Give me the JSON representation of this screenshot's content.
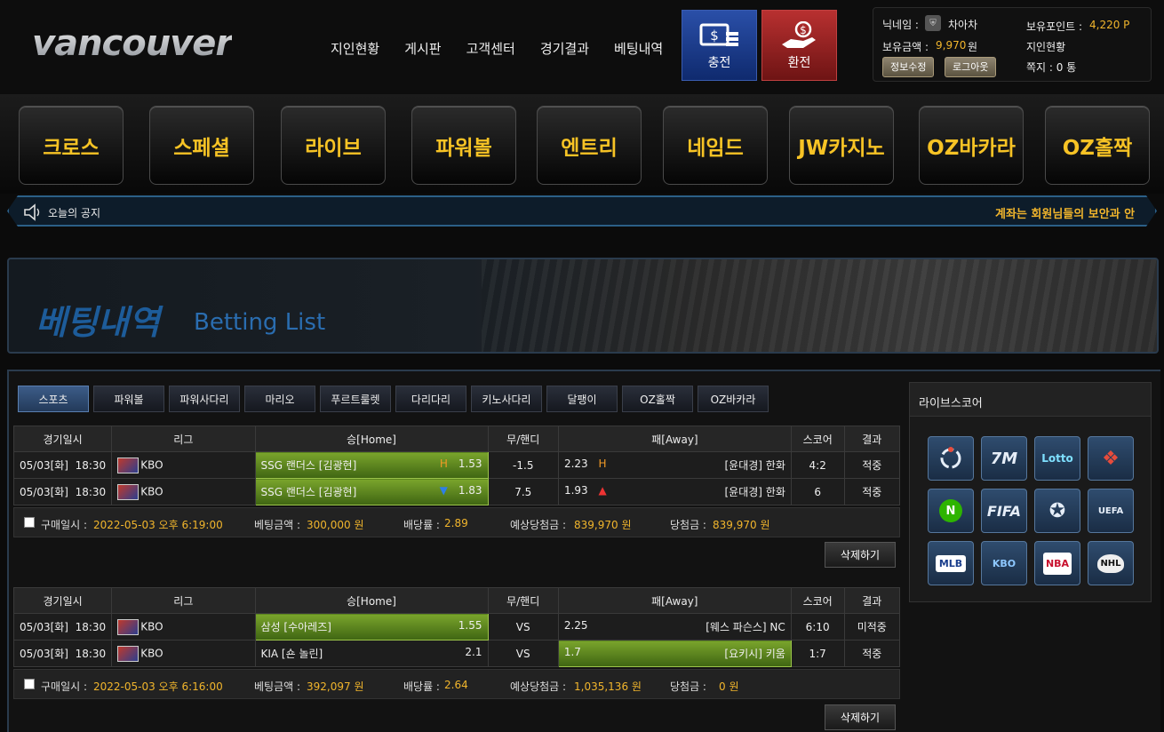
{
  "header": {
    "logo": "vancouver",
    "nav": [
      "지인현황",
      "게시판",
      "고객센터",
      "경기결과",
      "베팅내역"
    ],
    "charge_label": "충전",
    "exchange_label": "환전"
  },
  "user": {
    "nickname_label": "닉네임 :",
    "nickname": "차아차",
    "points_label": "보유포인트 :",
    "points": "4,220 P",
    "balance_label": "보유금액 :",
    "balance": "9,970",
    "balance_unit": "원",
    "friends_label": "지인현황",
    "memo_label": "쪽지 : 0 통",
    "edit_btn": "정보수정",
    "logout_btn": "로그아웃"
  },
  "games": [
    "크로스",
    "스페셜",
    "라이브",
    "파워볼",
    "엔트리",
    "네임드",
    "JW카지노",
    "OZ바카라",
    "OZ홀짝"
  ],
  "notice": {
    "label": "오늘의 공지",
    "text": "계좌는 회원님들의 보안과 안"
  },
  "banner": {
    "title_ko": "베팅내역",
    "title_en": "Betting List"
  },
  "tabs": [
    "스포츠",
    "파워볼",
    "파워사다리",
    "마리오",
    "푸르트룰렛",
    "다리다리",
    "키노사다리",
    "달팽이",
    "OZ홀짝",
    "OZ바카라"
  ],
  "table_headers": [
    "경기일시",
    "리그",
    "승[Home]",
    "무/핸디",
    "패[Away]",
    "스코어",
    "결과"
  ],
  "bets": [
    {
      "rows": [
        {
          "date": "05/03[화]  18:30",
          "league": "KBO",
          "home": "SSG 랜더스 [김광현]",
          "home_mark": "H",
          "home_odds": "1.53",
          "draw": "-1.5",
          "away_odds": "2.23",
          "away_mark": "H",
          "away": "[윤대경] 한화",
          "score": "4:2",
          "result": "적중"
        },
        {
          "date": "05/03[화]  18:30",
          "league": "KBO",
          "home": "SSG 랜더스 [김광현]",
          "home_mark": "▼",
          "home_odds": "1.83",
          "draw": "7.5",
          "away_odds": "1.93",
          "away_mark": "▲",
          "away": "[윤대경] 한화",
          "score": "6",
          "result": "적중"
        }
      ],
      "summary": {
        "time_label": "구매일시 :",
        "time": "2022-05-03 오후 6:19:00",
        "amount_label": "베팅금액 :",
        "amount": "300,000 원",
        "rate_label": "배당률 :",
        "rate": "2.89",
        "expected_label": "예상당첨금 :",
        "expected": "839,970 원",
        "win_label": "당첨금 :",
        "win": "839,970 원"
      },
      "delete": "삭제하기"
    },
    {
      "rows": [
        {
          "date": "05/03[화]  18:30",
          "league": "KBO",
          "home": "삼성 [수아레즈]",
          "home_mark": "",
          "home_odds": "1.55",
          "draw": "VS",
          "away_odds": "2.25",
          "away_mark": "",
          "away": "[웨스 파슨스] NC",
          "score": "6:10",
          "result": "미적중"
        },
        {
          "date": "05/03[화]  18:30",
          "league": "KBO",
          "home": "KIA [숀 놀린]",
          "home_mark": "",
          "home_odds": "2.1",
          "draw": "VS",
          "away_odds": "1.7",
          "away_mark": "",
          "away": "[요키시] 키움",
          "score": "1:7",
          "result": "적중"
        }
      ],
      "summary": {
        "time_label": "구매일시 :",
        "time": "2022-05-03 오후 6:16:00",
        "amount_label": "베팅금액 :",
        "amount": "392,097 원",
        "rate_label": "배당률 :",
        "rate": "2.64",
        "expected_label": "예상당첨금 :",
        "expected": "1,035,136 원",
        "win_label": "당첨금 :",
        "win": "0 원"
      },
      "delete": "삭제하기"
    }
  ],
  "livescore": {
    "title": "라이브스코어",
    "icons": [
      "livescore-icon",
      "7M",
      "Lotto",
      "diamond-icon",
      "N",
      "FIFA",
      "ball-icon",
      "UEFA",
      "MLB",
      "KBO",
      "NBA",
      "NHL"
    ]
  },
  "colors": {
    "accent": "#f7c325",
    "selected": "#7aa52c",
    "win": "#2e7fe5",
    "lose": "#e33333"
  }
}
